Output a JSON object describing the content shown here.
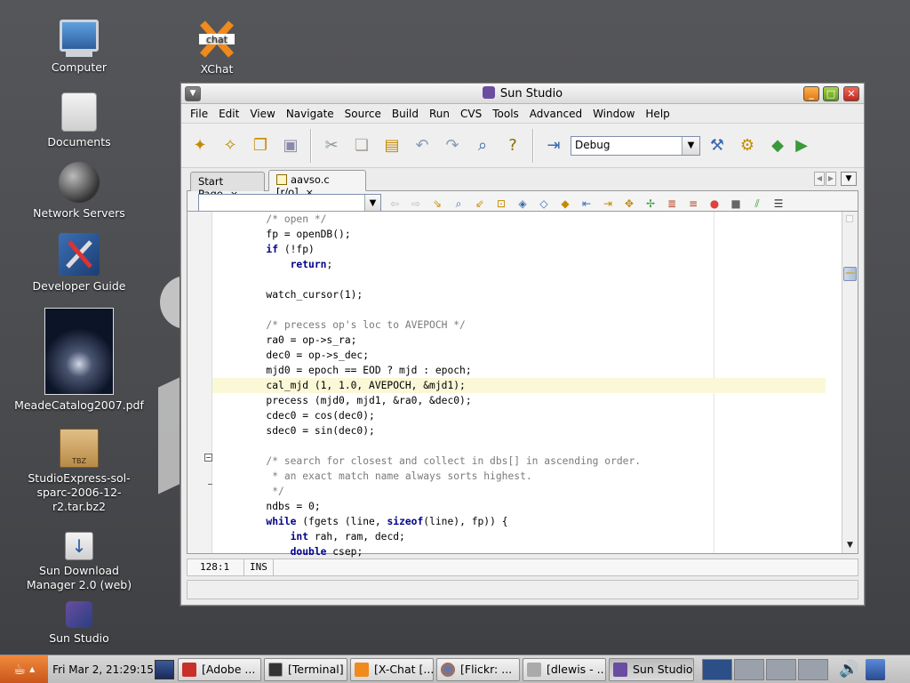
{
  "desktop": {
    "icons": [
      {
        "label": "Computer",
        "icon": "computer-icon"
      },
      {
        "label": "XChat",
        "icon": "xchat-icon"
      },
      {
        "label": "Documents",
        "icon": "folder-icon"
      },
      {
        "label": "Network Servers",
        "icon": "globe-icon"
      },
      {
        "label": "Developer Guide",
        "icon": "tools-icon"
      },
      {
        "label": "MeadeCatalog2007.pdf",
        "icon": "pdf-thumbnail-icon"
      },
      {
        "label": "StudioExpress-sol-sparc-2006-12-r2.tar.bz2",
        "icon": "archive-icon",
        "badge": "TBZ"
      },
      {
        "label": "Sun Download Manager 2.0 (web)",
        "icon": "download-icon"
      },
      {
        "label": "Sun Studio",
        "icon": "sun-studio-icon"
      }
    ]
  },
  "window": {
    "title": "Sun Studio",
    "menu": [
      "File",
      "Edit",
      "View",
      "Navigate",
      "Source",
      "Build",
      "Run",
      "CVS",
      "Tools",
      "Advanced",
      "Window",
      "Help"
    ],
    "config_value": "Debug",
    "tabs": [
      {
        "label": "Start Page",
        "active": false
      },
      {
        "label": "aavso.c [r/o]",
        "active": true
      }
    ],
    "status": {
      "position": "128:1",
      "mode": "INS"
    }
  },
  "code_lines": [
    "        /* open */",
    "        fp = openDB();",
    "        if (!fp)",
    "            return;",
    "",
    "        watch_cursor(1);",
    "",
    "        /* precess op's loc to AVEPOCH */",
    "        ra0 = op->s_ra;",
    "        dec0 = op->s_dec;",
    "        mjd0 = epoch == EOD ? mjd : epoch;",
    "        cal_mjd (1, 1.0, AVEPOCH, &mjd1);",
    "        precess (mjd0, mjd1, &ra0, &dec0);",
    "        cdec0 = cos(dec0);",
    "        sdec0 = sin(dec0);",
    "",
    "        /* search for closest and collect in dbs[] in ascending order.",
    "         * an exact match name always sorts highest.",
    "         */",
    "        ndbs = 0;",
    "        while (fgets (line, sizeof(line), fp)) {",
    "            int rah, ram, decd;",
    "            double csep;"
  ],
  "taskbar": {
    "clock": "Fri Mar  2, 21:29:15",
    "buttons": [
      {
        "label": "[Adobe ...",
        "active": false
      },
      {
        "label": "[Terminal]",
        "active": false
      },
      {
        "label": "[X-Chat [...",
        "active": false
      },
      {
        "label": "[Flickr: ...",
        "active": false
      },
      {
        "label": "[dlewis - ...",
        "active": false
      },
      {
        "label": "Sun Studio",
        "active": true
      }
    ]
  }
}
